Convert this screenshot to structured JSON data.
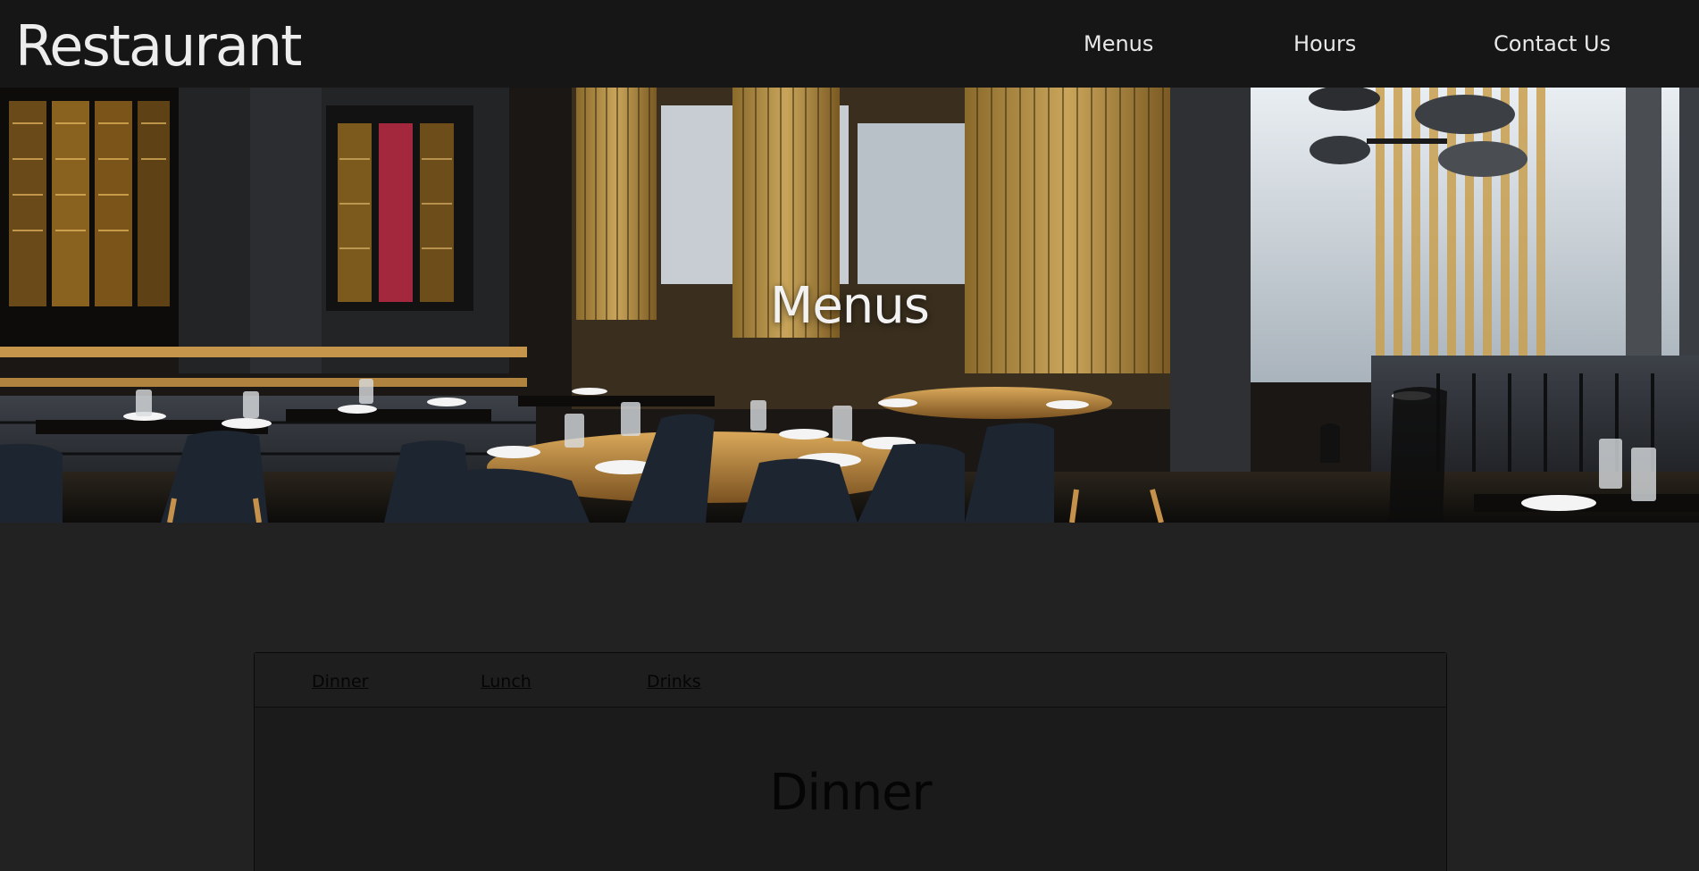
{
  "brand": {
    "name": "Restaurant"
  },
  "nav": {
    "items": [
      {
        "label": "Menus"
      },
      {
        "label": "Hours"
      },
      {
        "label": "Contact Us"
      }
    ]
  },
  "hero": {
    "title": "Menus",
    "image_description": "restaurant-interior-photo"
  },
  "menu_tabs": {
    "tabs": [
      {
        "label": "Dinner"
      },
      {
        "label": "Lunch"
      },
      {
        "label": "Drinks"
      }
    ],
    "active_heading": "Dinner"
  },
  "colors": {
    "header_bg": "#161616",
    "page_bg": "#222222",
    "panel_bg": "#1b1b1b",
    "text_light": "#e8e8e8",
    "text_dark": "#050505"
  }
}
